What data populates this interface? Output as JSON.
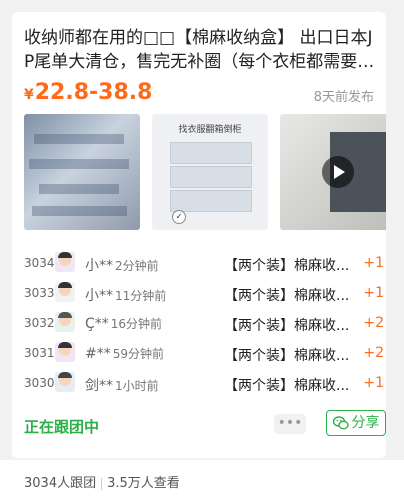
{
  "product": {
    "title": "收纳师都在用的□□【棉麻收纳盒】 出口日本JP尾单大清仓，售完无补圈（每个衣柜都需要的…",
    "currency": "¥",
    "price_range": "22.8-38.8",
    "posted": "8天前发布",
    "images": [
      {
        "icon": "folded-clothes-photo"
      },
      {
        "icon": "wardrobe-organizer-photo",
        "caption": "找衣服翻箱倒柜"
      },
      {
        "icon": "video-thumbnail",
        "has_play": true
      }
    ]
  },
  "orders": [
    {
      "num": "3034",
      "name": "小**",
      "time": "2分钟前",
      "product": "【两个装】棉麻收...",
      "qty": "+1"
    },
    {
      "num": "3033",
      "name": "小**",
      "time": "11分钟前",
      "product": "【两个装】棉麻收...",
      "qty": "+1"
    },
    {
      "num": "3032",
      "name": "Ç**",
      "time": "16分钟前",
      "product": "【两个装】棉麻收...",
      "qty": "+2"
    },
    {
      "num": "3031",
      "name": "#**",
      "time": "59分钟前",
      "product": "【两个装】棉麻收...",
      "qty": "+2"
    },
    {
      "num": "3030",
      "name": "剑**",
      "time": "1小时前",
      "product": "【两个装】棉麻收...",
      "qty": "+1"
    }
  ],
  "status": "正在跟团中",
  "more_label": "•••",
  "share_label": "分享",
  "footer": {
    "joined": "3034人跟团",
    "views": "3.5万人查看"
  },
  "colors": {
    "accent_orange": "#ff6a1a",
    "accent_green": "#2bb047"
  }
}
